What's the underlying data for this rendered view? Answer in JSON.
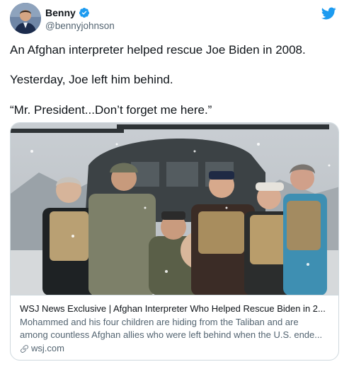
{
  "author": {
    "name": "Benny",
    "handle": "@bennyjohnson",
    "verified": true,
    "avatar_icon": "person-avatar"
  },
  "tweet": {
    "lines": [
      "An Afghan interpreter helped rescue Joe Biden in 2008.",
      "Yesterday, Joe left him behind.",
      "“Mr. President...Don’t forget me here.”"
    ]
  },
  "card": {
    "title": "WSJ News Exclusive | Afghan Interpreter Who Helped Rescue Biden in 2...",
    "description_lines": [
      "Mohammed and his four children are hiding from the Taliban and are",
      "among countless Afghan allies who were left behind when the U.S. ende..."
    ],
    "domain": "wsj.com",
    "link_icon": "link-icon",
    "image_icon": "photo-group-soldiers-helicopter"
  },
  "colors": {
    "twitter_blue": "#1d9bf0",
    "text_primary": "#0f1419",
    "text_secondary": "#536471",
    "border": "#cfd9de"
  }
}
